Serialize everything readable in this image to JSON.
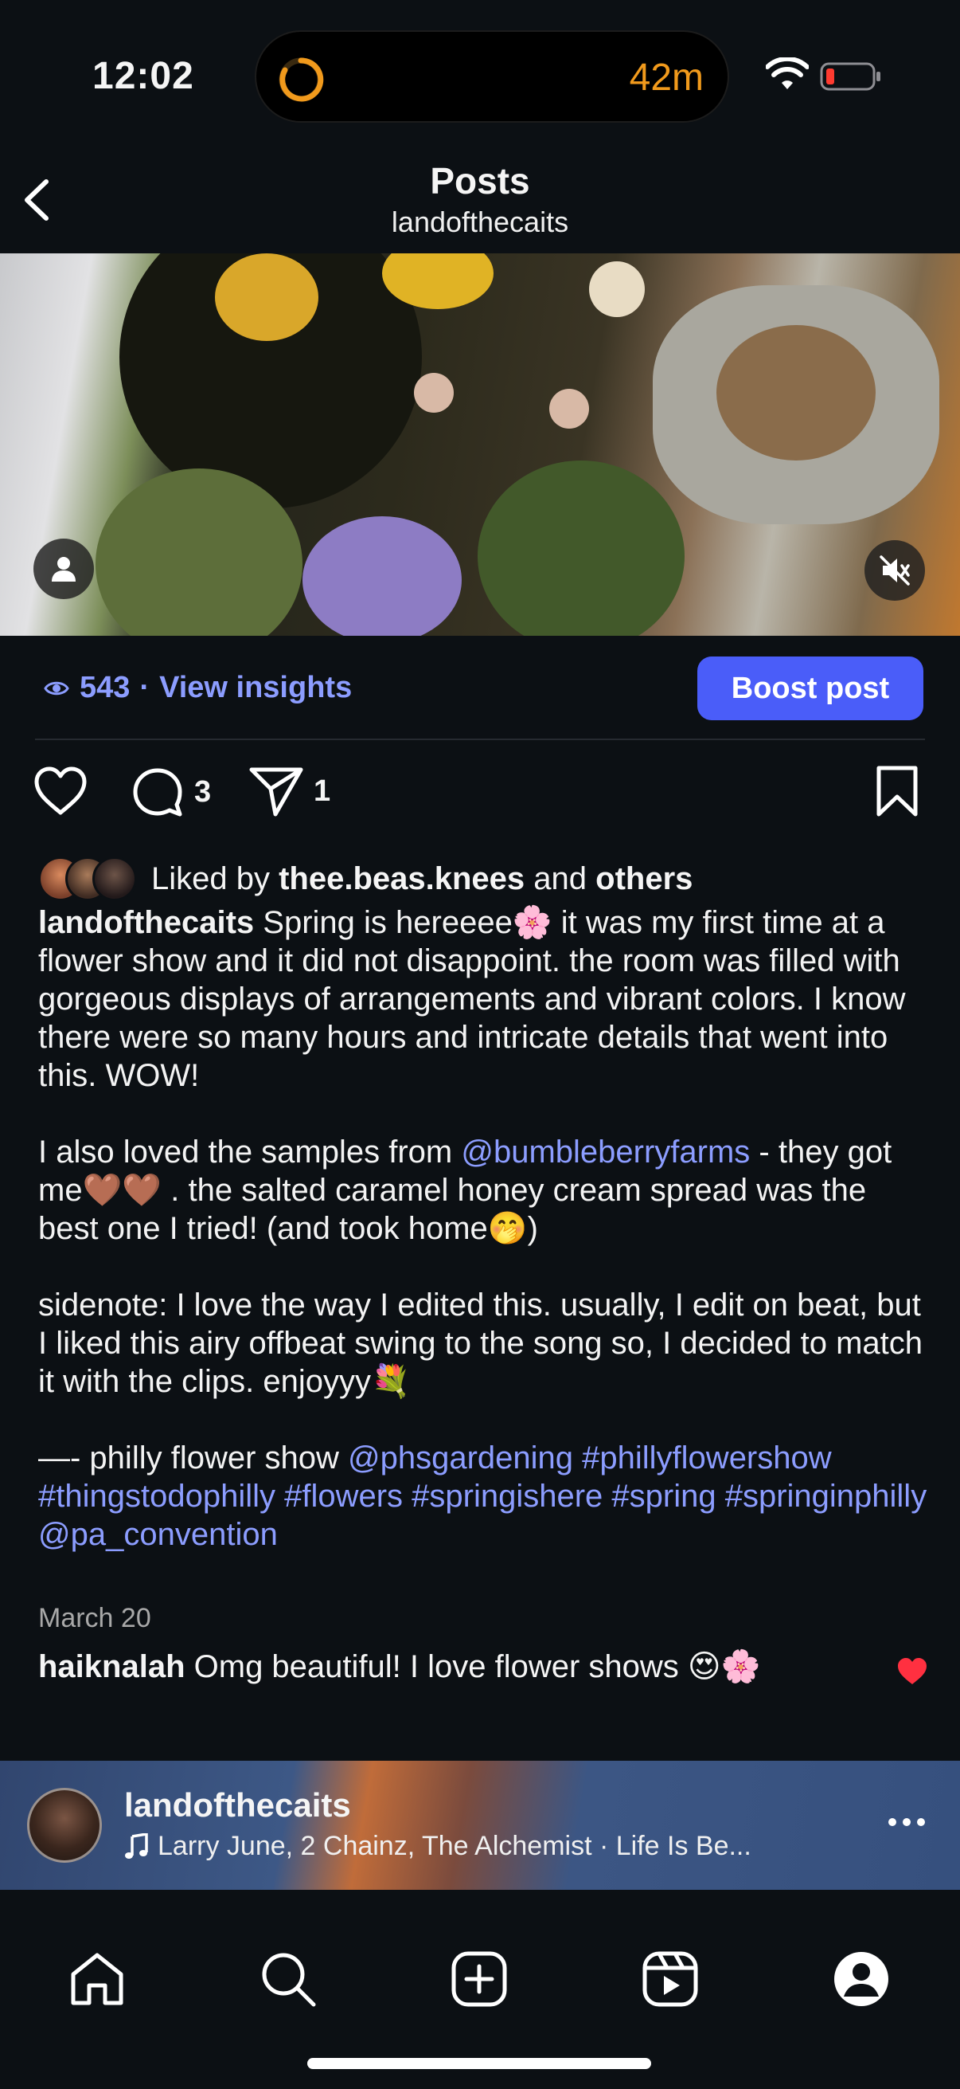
{
  "status_bar": {
    "time": "12:02",
    "activity_timer": "42m",
    "icons": [
      "wifi-icon",
      "battery-low-icon",
      "timer-icon"
    ],
    "accent_color": "#f19a1c"
  },
  "header": {
    "title": "Posts",
    "subtitle": "landofthecaits"
  },
  "insights": {
    "views": "543",
    "separator": "·",
    "link_label": "View insights",
    "boost_label": "Boost post",
    "boost_color": "#4a5df9"
  },
  "actions": {
    "comment_count": "3",
    "share_count": "1"
  },
  "likes": {
    "prefix": "Liked by",
    "first_user": "thee.beas.knees",
    "conjunction": "and",
    "others": "others"
  },
  "caption": {
    "username": "landofthecaits",
    "p1": "Spring is hereeee🌸 it was my first time at a flower show and it did not disappoint. the room was filled with gorgeous displays of arrangements and vibrant colors. I know there were so many hours and intricate details that went into this. WOW!",
    "p2_a": "I also loved the samples from",
    "p2_mention": "@bumbleberryfarms",
    "p2_b": "- they got me🤎🤎 . the salted caramel honey cream spread was the best one I tried! (and took home🤭)",
    "p3": "sidenote: I love the way I edited this. usually, I edit on beat, but I liked this airy offbeat swing to the song so, I decided to match it with the clips. enjoyyy💐",
    "p4_a": "—- philly flower show",
    "p4_tags": "@phsgardening #phillyflowershow #thingstodophilly #flowers #springishere #spring #springinphilly @pa_convention"
  },
  "date": "March 20",
  "comment": {
    "username": "haiknalah",
    "text": "Omg beautiful! I love flower shows 😍🌸"
  },
  "now_playing": {
    "username": "landofthecaits",
    "track": "Larry June, 2 Chainz, The Alchemist · Life Is Be..."
  },
  "nav": [
    "home-icon",
    "search-icon",
    "create-icon",
    "reels-icon",
    "profile-icon"
  ]
}
